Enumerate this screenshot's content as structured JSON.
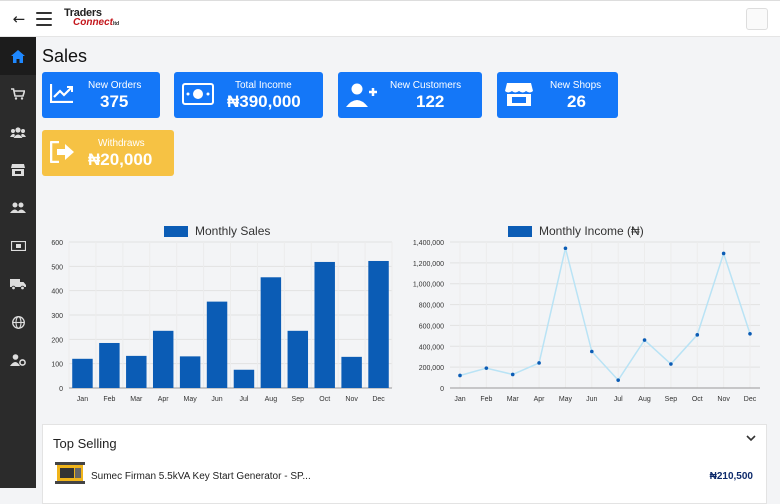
{
  "header": {
    "logo_line1": "Traders",
    "logo_line2": "Connect",
    "logo_suffix": "ltd"
  },
  "sidebar": {
    "items": [
      {
        "icon": "home-icon",
        "active": true
      },
      {
        "icon": "cart-icon"
      },
      {
        "icon": "users-icon"
      },
      {
        "icon": "store-icon"
      },
      {
        "icon": "user-group-icon"
      },
      {
        "icon": "cash-icon"
      },
      {
        "icon": "truck-icon"
      },
      {
        "icon": "globe-icon"
      },
      {
        "icon": "user-settings-icon"
      }
    ]
  },
  "page": {
    "title": "Sales"
  },
  "cards": {
    "new_orders": {
      "label": "New Orders",
      "value": "375"
    },
    "total_income": {
      "label": "Total Income",
      "value": "₦390,000"
    },
    "new_customers": {
      "label": "New Customers",
      "value": "122"
    },
    "new_shops": {
      "label": "New Shops",
      "value": "26"
    },
    "withdraws": {
      "label": "Withdraws",
      "value": "₦20,000"
    }
  },
  "colors": {
    "primary": "#1477f8",
    "warning": "#f6c244",
    "bar": "#0b5cb5",
    "line": "#b9e3f5",
    "point": "#0b5cb5",
    "sidebar": "#2b2b2b"
  },
  "chart_data": [
    {
      "type": "bar",
      "legend": "Monthly Sales",
      "categories": [
        "Jan",
        "Feb",
        "Mar",
        "Apr",
        "May",
        "Jun",
        "Jul",
        "Aug",
        "Sep",
        "Oct",
        "Nov",
        "Dec"
      ],
      "values": [
        120,
        185,
        132,
        235,
        130,
        355,
        75,
        455,
        235,
        518,
        128,
        522
      ],
      "ylim": [
        0,
        600
      ],
      "yticks": [
        0,
        100,
        200,
        300,
        400,
        500,
        600
      ],
      "grid": true
    },
    {
      "type": "line",
      "legend": "Monthly Income (₦)",
      "categories": [
        "Jan",
        "Feb",
        "Mar",
        "Apr",
        "May",
        "Jun",
        "Jul",
        "Aug",
        "Sep",
        "Oct",
        "Nov",
        "Dec"
      ],
      "values": [
        120000,
        190000,
        130000,
        240000,
        1340000,
        350000,
        75000,
        460000,
        230000,
        510000,
        1290000,
        520000
      ],
      "ylim": [
        0,
        1400000
      ],
      "yticks": [
        "0",
        "200,000",
        "400,000",
        "600,000",
        "800,000",
        "1,000,000",
        "1,200,000",
        "1,400,000"
      ],
      "grid": true
    }
  ],
  "top_selling": {
    "title": "Top Selling",
    "items": [
      {
        "name": "Sumec Firman 5.5kVA Key Start Generator - SP...",
        "price": "₦210,500"
      }
    ]
  }
}
